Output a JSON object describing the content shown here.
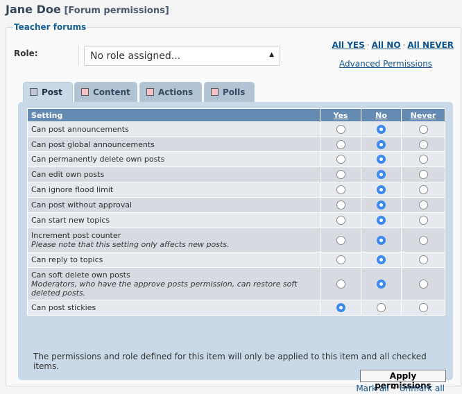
{
  "header": {
    "name": "Jane Doe",
    "subtitle": "[Forum permissions]"
  },
  "fieldset": {
    "legend": "Teacher forums"
  },
  "role": {
    "label": "Role:",
    "selected": "No role assigned..."
  },
  "quick_links": {
    "all_yes": "All YES",
    "all_no": "All NO",
    "all_never": "All NEVER",
    "separator": "·",
    "advanced": "Advanced Permissions"
  },
  "tabs": [
    {
      "label": "Post",
      "swatch": "#c1c4d9",
      "active": true
    },
    {
      "label": "Content",
      "swatch": "#f3c1c6",
      "active": false
    },
    {
      "label": "Actions",
      "swatch": "#f3c1c6",
      "active": false
    },
    {
      "label": "Polls",
      "swatch": "#f3c1c6",
      "active": false
    }
  ],
  "table": {
    "headers": {
      "setting": "Setting",
      "yes": "Yes",
      "no": "No",
      "never": "Never"
    },
    "rows": [
      {
        "label": "Can post announcements",
        "note": "",
        "value": "no"
      },
      {
        "label": "Can post global announcements",
        "note": "",
        "value": "no"
      },
      {
        "label": "Can permanently delete own posts",
        "note": "",
        "value": "no"
      },
      {
        "label": "Can edit own posts",
        "note": "",
        "value": "no"
      },
      {
        "label": "Can ignore flood limit",
        "note": "",
        "value": "no"
      },
      {
        "label": "Can post without approval",
        "note": "",
        "value": "no"
      },
      {
        "label": "Can start new topics",
        "note": "",
        "value": "no"
      },
      {
        "label": "Increment post counter",
        "note": "Please note that this setting only affects new posts.",
        "value": "no"
      },
      {
        "label": "Can reply to topics",
        "note": "",
        "value": "no"
      },
      {
        "label": "Can soft delete own posts",
        "note": "Moderators, who have the approve posts permission, can restore soft deleted posts.",
        "value": "no"
      },
      {
        "label": "Can post stickies",
        "note": "",
        "value": "yes"
      }
    ]
  },
  "footer": {
    "note": "The permissions and role defined for this item will only be applied to this item and all checked items.",
    "apply_label": "Apply permissions",
    "mark_all": "Mark all",
    "unmark_all": "Unmark all",
    "separator": "•"
  },
  "colors": {
    "accent": "#105289",
    "header_row": "#658bb3",
    "radio_on": "#3b8aed",
    "panel": "#c9d9e7"
  }
}
